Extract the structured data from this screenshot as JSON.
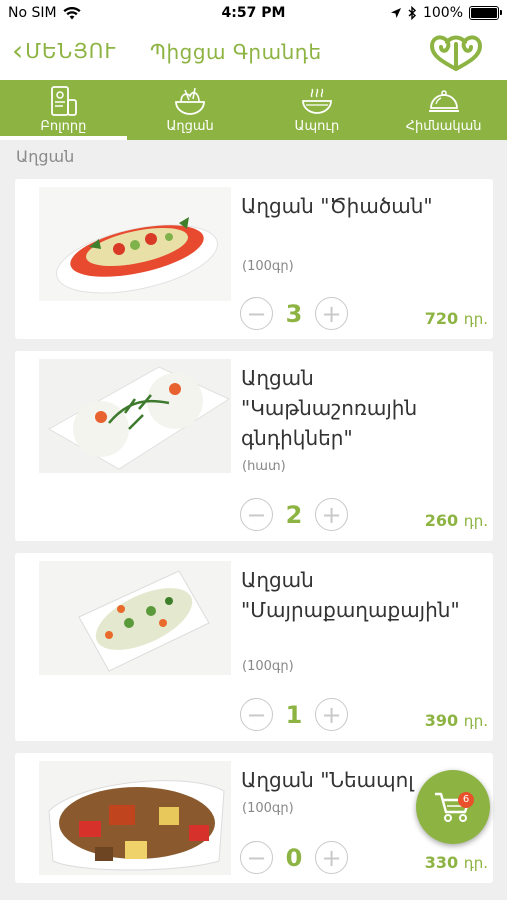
{
  "status_bar": {
    "carrier": "No SIM",
    "time": "4:57 PM",
    "battery": "100%"
  },
  "header": {
    "back_label": "ՄԵՆՅՈՒ",
    "title": "Պիցցա Գրանդե"
  },
  "tabs": [
    {
      "label": "Բոլորը",
      "icon": "all-items-icon",
      "active": true
    },
    {
      "label": "Աղցան",
      "icon": "salad-bowl-icon",
      "active": false
    },
    {
      "label": "Ապուր",
      "icon": "soup-bowl-icon",
      "active": false
    },
    {
      "label": "Հիմնական",
      "icon": "cloche-icon",
      "active": false
    }
  ],
  "section": {
    "title": "Աղցան"
  },
  "items": [
    {
      "name": "Աղցան \"Ծիածան\"",
      "unit": "(100գր)",
      "quantity": "3",
      "price": "720",
      "currency": "դր.",
      "image": "salad-photo-tomato"
    },
    {
      "name": "Աղցան \"Կաթնաշոռային գնդիկներ\"",
      "unit": "(հատ)",
      "quantity": "2",
      "price": "260",
      "currency": "դր.",
      "image": "cheese-balls-photo"
    },
    {
      "name": "Աղցան \"Մայրաքաղաքային\"",
      "unit": "(100գր)",
      "quantity": "1",
      "price": "390",
      "currency": "դր.",
      "image": "capital-salad-photo"
    },
    {
      "name": "Աղցան \"Նեապոլ",
      "unit": "(100գր)",
      "quantity": "0",
      "price": "330",
      "currency": "դր.",
      "image": "meat-salad-photo"
    }
  ],
  "controls": {
    "minus": "−",
    "plus": "+"
  },
  "cart": {
    "badge": "6",
    "icon": "shopping-cart-icon"
  },
  "colors": {
    "accent": "#8db443",
    "badge": "#e8512b",
    "background": "#efefef"
  }
}
